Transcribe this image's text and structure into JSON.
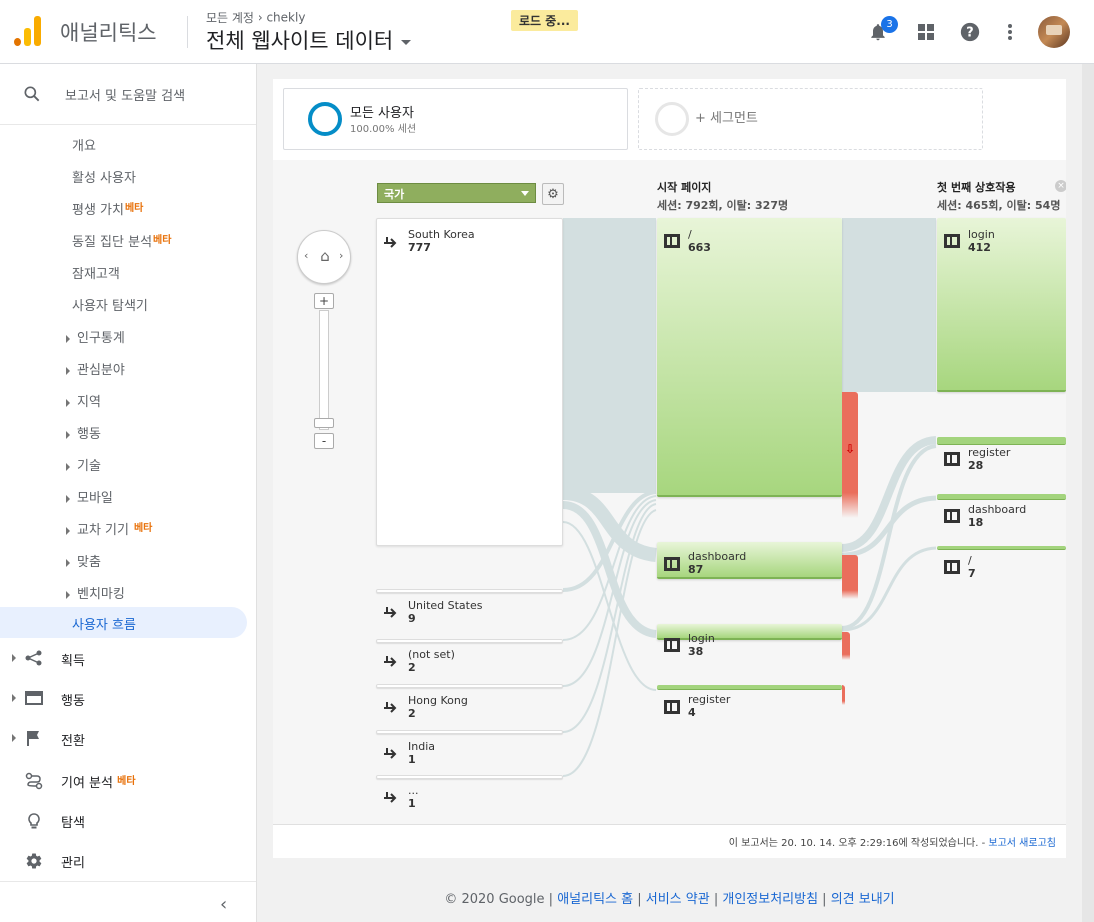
{
  "header": {
    "app_name": "애널리틱스",
    "breadcrumb_root": "모든 계정",
    "breadcrumb_sep": "›",
    "account": "chekly",
    "view_name": "전체 웹사이트 데이터",
    "loading_label": "로드 중...",
    "notification_count": "3",
    "brand_colors": {
      "logo_light": "#fbbc04",
      "logo_dark": "#e37400"
    }
  },
  "sidebar": {
    "search_placeholder": "보고서 및 도움말 검색",
    "items": [
      {
        "label": "개요"
      },
      {
        "label": "활성 사용자"
      },
      {
        "label": "평생 가치",
        "badge": "베타"
      },
      {
        "label": "동질 집단 분석",
        "badge": "베타"
      },
      {
        "label": "잠재고객"
      },
      {
        "label": "사용자 탐색기"
      },
      {
        "label": "인구통계"
      },
      {
        "label": "관심분야"
      },
      {
        "label": "지역"
      },
      {
        "label": "행동"
      },
      {
        "label": "기술"
      },
      {
        "label": "모바일"
      },
      {
        "label": "교차 기기",
        "badge": "베타"
      },
      {
        "label": "맞춤"
      },
      {
        "label": "벤치마킹"
      }
    ],
    "active_item": "사용자 흐름",
    "sections": [
      {
        "label": "획득",
        "icon": "acquisition-icon"
      },
      {
        "label": "행동",
        "icon": "behavior-icon"
      },
      {
        "label": "전환",
        "icon": "flag-icon"
      },
      {
        "label": "기여 분석",
        "icon": "attribution-icon",
        "badge": "베타"
      },
      {
        "label": "탐색",
        "icon": "lightbulb-icon"
      },
      {
        "label": "관리",
        "icon": "gear-icon"
      }
    ],
    "collapse_glyph": "‹"
  },
  "segments": {
    "active": {
      "name": "모든 사용자",
      "detail": "100.00% 세션"
    },
    "add": "+ 세그먼트"
  },
  "flow": {
    "dimension": "국가",
    "col_start_title": "시작 페이지",
    "col_start_stats": "세션: 792회, 이탈: 327명",
    "col_first_title": "첫 번째 상호작용",
    "col_first_stats": "세션: 465회, 이탈: 54명",
    "countries": [
      {
        "name": "South Korea",
        "value": "777"
      },
      {
        "name": "United States",
        "value": "9"
      },
      {
        "name": "(not set)",
        "value": "2"
      },
      {
        "name": "Hong Kong",
        "value": "2"
      },
      {
        "name": "India",
        "value": "1"
      },
      {
        "name": "...",
        "value": "1"
      }
    ],
    "start_pages": [
      {
        "name": "/",
        "value": "663"
      },
      {
        "name": "dashboard",
        "value": "87"
      },
      {
        "name": "login",
        "value": "38"
      },
      {
        "name": "register",
        "value": "4"
      }
    ],
    "first_interaction": [
      {
        "name": "login",
        "value": "412"
      },
      {
        "name": "register",
        "value": "28"
      },
      {
        "name": "dashboard",
        "value": "18"
      },
      {
        "name": "/",
        "value": "7"
      }
    ],
    "colors": {
      "node_green": "#a7d67e",
      "dropoff": "#ea6e5c",
      "link": "#d3dfe0"
    }
  },
  "report_footer": {
    "text": "이 보고서는 20. 10. 14. 오후 2:29:16에 작성되었습니다. - ",
    "refresh": "보고서 새로고침"
  },
  "page_footer": {
    "copyright": "© 2020 Google",
    "sep": " | ",
    "links": [
      "애널리틱스 홈",
      "서비스 약관",
      "개인정보처리방침",
      "의견 보내기"
    ]
  }
}
